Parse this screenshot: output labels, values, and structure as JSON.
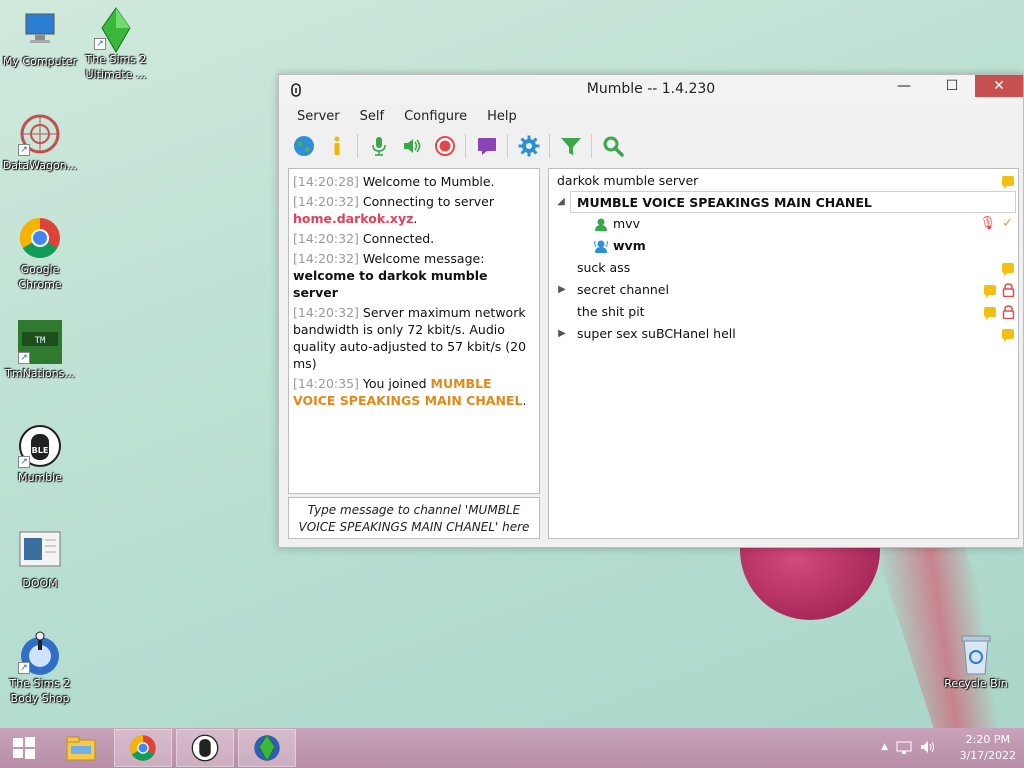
{
  "desktop": {
    "icons": [
      {
        "label": "My Computer"
      },
      {
        "label": "The Sims 2 Ultimate ..."
      },
      {
        "label": "DataWagon..."
      },
      {
        "label": "Google Chrome"
      },
      {
        "label": "TmNations..."
      },
      {
        "label": "Mumble"
      },
      {
        "label": "DOOM"
      },
      {
        "label": "The Sims 2 Body Shop"
      },
      {
        "label": "Recycle Bin"
      }
    ]
  },
  "window": {
    "title": "Mumble -- 1.4.230",
    "controls": {
      "minimize": "—",
      "maximize": "☐",
      "close": "✕"
    },
    "menu": [
      "Server",
      "Self",
      "Configure",
      "Help"
    ],
    "toolbar_icons": [
      "globe-icon",
      "info-icon",
      "microphone-icon",
      "speaker-icon",
      "record-icon",
      "chat-icon",
      "gear-icon",
      "filter-icon",
      "search-icon"
    ]
  },
  "log": [
    {
      "ts": "[14:20:28]",
      "text": "Welcome to Mumble."
    },
    {
      "ts": "[14:20:32]",
      "text": "Connecting to server ",
      "hl": "home.darkok.xyz",
      "tail": "."
    },
    {
      "ts": "[14:20:32]",
      "text": "Connected."
    },
    {
      "ts": "[14:20:32]",
      "text": "Welcome message: ",
      "bold": "welcome to darkok mumble server"
    },
    {
      "ts": "[14:20:32]",
      "text": "Server maximum network bandwidth is only 72 kbit/s. Audio quality auto-adjusted to 57 kbit/s (20 ms)"
    },
    {
      "ts": "[14:20:35]",
      "text": "You joined ",
      "hl": "MUMBLE VOICE SPEAKINGS MAIN CHANEL",
      "tail": "."
    }
  ],
  "chat_placeholder": "Type message to channel 'MUMBLE VOICE SPEAKINGS MAIN CHANEL' here",
  "tree": {
    "server": "darkok mumble server",
    "current_channel": "MUMBLE VOICE SPEAKINGS MAIN CHANEL",
    "users": [
      {
        "name": "mvv",
        "bold": false
      },
      {
        "name": "wvm",
        "bold": true
      }
    ],
    "channels": [
      {
        "name": "suck ass",
        "expandable": false,
        "locked": false
      },
      {
        "name": "secret channel",
        "expandable": true,
        "locked": true
      },
      {
        "name": "the shit pit",
        "expandable": false,
        "locked": true
      },
      {
        "name": "super sex suBCHanel hell",
        "expandable": true,
        "locked": false
      }
    ]
  },
  "taskbar": {
    "time": "2:20 PM",
    "date": "3/17/2022"
  },
  "colors": {
    "accent_red": "#e0405a",
    "accent_orange": "#e08a1a",
    "taskbar": "#c49fb4",
    "note_yellow": "#f2c013"
  }
}
